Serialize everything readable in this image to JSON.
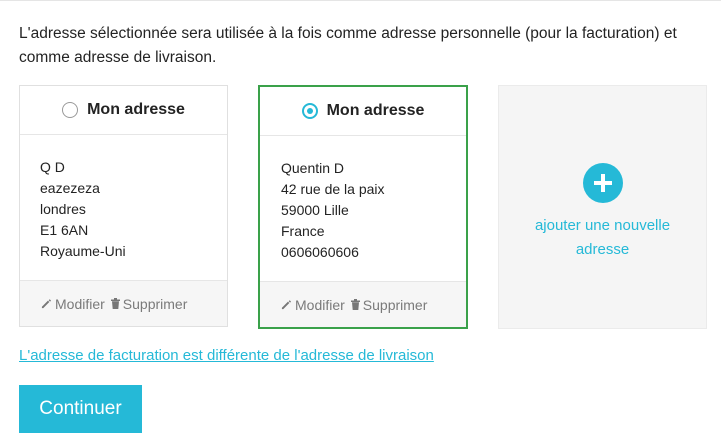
{
  "intro_text": "L'adresse sélectionnée sera utilisée à la fois comme adresse personnelle (pour la facturation) et comme adresse de livraison.",
  "addresses": [
    {
      "alias": "Mon adresse",
      "selected": false,
      "lines": [
        "Q D",
        "eazezeza",
        "londres",
        "E1 6AN",
        "Royaume-Uni"
      ],
      "edit_label": "Modifier",
      "delete_label": "Supprimer"
    },
    {
      "alias": "Mon adresse",
      "selected": true,
      "lines": [
        "Quentin D",
        "42 rue de la paix",
        "59000 Lille",
        "France",
        "0606060606"
      ],
      "edit_label": "Modifier",
      "delete_label": "Supprimer"
    }
  ],
  "add_new": {
    "label": "ajouter une nouvelle adresse",
    "icon": "plus-circle-icon"
  },
  "diff_link": "L'adresse de facturation est différente de l'adresse de livraison",
  "continue_button": "Continuer",
  "colors": {
    "accent": "#25b9d7",
    "selected_border": "#3aa14a",
    "text": "#232323",
    "muted": "#7a7a7a"
  }
}
